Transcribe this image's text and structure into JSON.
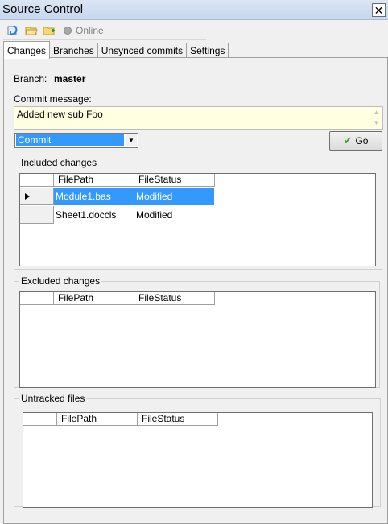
{
  "window": {
    "title": "Source Control",
    "close_glyph": "✕"
  },
  "toolbar": {
    "icons": [
      "refresh-icon",
      "open-folder-icon",
      "new-folder-icon"
    ],
    "status_text": "Online",
    "status_icon": "status-dot-icon"
  },
  "tabs": [
    {
      "label": "Changes",
      "active": true
    },
    {
      "label": "Branches",
      "active": false
    },
    {
      "label": "Unsynced commits",
      "active": false
    },
    {
      "label": "Settings",
      "active": false
    }
  ],
  "branch": {
    "label": "Branch:",
    "value": "master"
  },
  "commit": {
    "label": "Commit message:",
    "message": "Added new sub Foo",
    "action_value": "Commit",
    "go_label": "Go"
  },
  "included": {
    "title": "Included changes",
    "columns": [
      "FilePath",
      "FileStatus"
    ],
    "rows": [
      {
        "path": "Module1.bas",
        "status": "Modified",
        "selected": true
      },
      {
        "path": "Sheet1.doccls",
        "status": "Modified",
        "selected": false
      }
    ]
  },
  "excluded": {
    "title": "Excluded changes",
    "columns": [
      "FilePath",
      "FileStatus"
    ]
  },
  "untracked": {
    "title": "Untracked files",
    "columns": [
      "FilePath",
      "FileStatus"
    ]
  },
  "colors": {
    "selection": "#3399ff",
    "commit_bg": "#ffffe1",
    "titlebar": "#c6d6ec"
  }
}
